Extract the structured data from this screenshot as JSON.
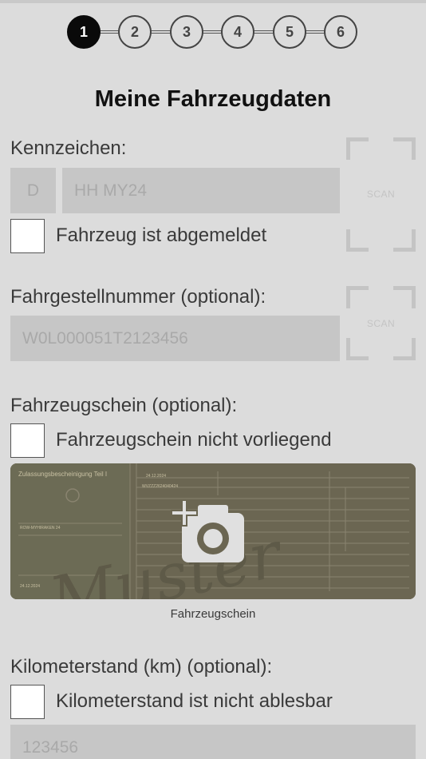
{
  "stepper": {
    "steps": [
      "1",
      "2",
      "3",
      "4",
      "5",
      "6"
    ],
    "active_step": 1
  },
  "page": {
    "title": "Meine Fahrzeugdaten"
  },
  "plate": {
    "label": "Kennzeichen:",
    "country_placeholder": "D",
    "number_placeholder": "HH MY24",
    "scan_label": "SCAN",
    "deregistered_label": "Fahrzeug ist abgemeldet"
  },
  "vin": {
    "label": "Fahrgestellnummer (optional):",
    "placeholder": "W0L000051T2123456",
    "scan_label": "SCAN"
  },
  "registration": {
    "label": "Fahrzeugschein (optional):",
    "unavailable_label": "Fahrzeugschein nicht vorliegend",
    "image_caption": "Fahrzeugschein",
    "document": {
      "header": "Zulassungsbescheinigung Teil I",
      "date_1": "24.12.2024",
      "date_2": "24.12.2024",
      "plate_text": "ROW-MYHIRAKEN 24",
      "vin_text": "WVZZZ2624040424",
      "watermark": "Muster"
    },
    "camera_icon": "camera-add-icon"
  },
  "mileage": {
    "label": "Kilometerstand (km) (optional):",
    "unreadable_label": "Kilometerstand ist nicht ablesbar",
    "placeholder": "123456"
  },
  "colors": {
    "background": "#dcdcdc",
    "active_step": "#0a0a0a",
    "field": "#c6c6c6",
    "document_tint": "#6f6a55"
  }
}
